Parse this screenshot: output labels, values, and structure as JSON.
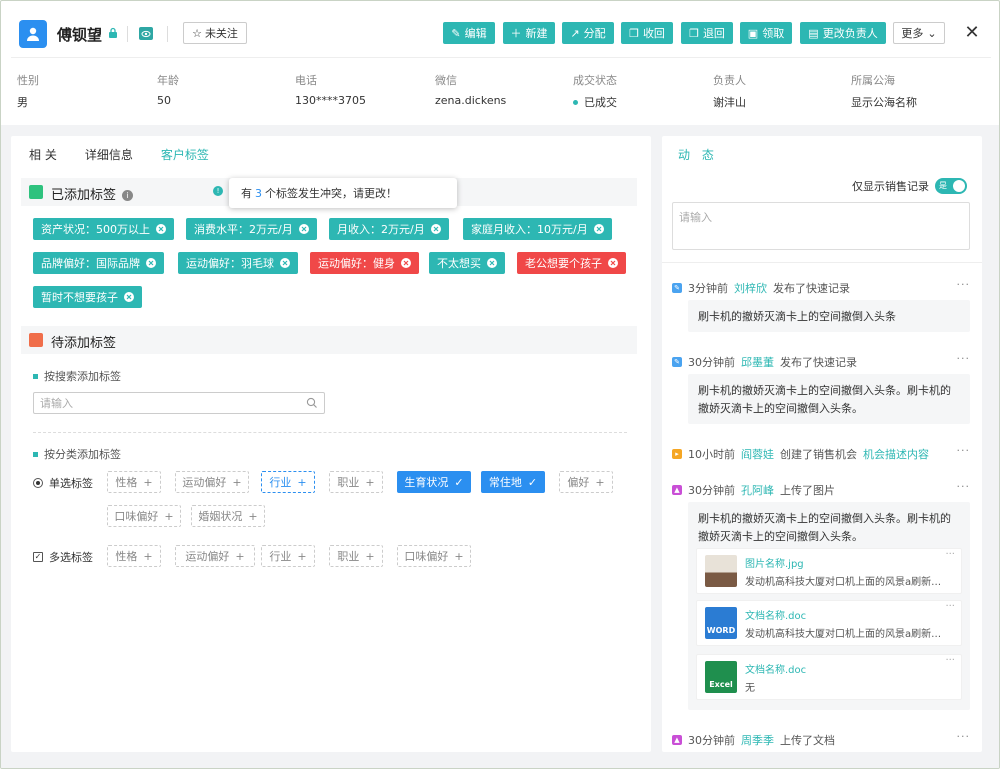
{
  "header": {
    "name": "傅钡望",
    "follow_label": "未关注",
    "actions": [
      "编辑",
      "新建",
      "分配",
      "收回",
      "退回",
      "领取",
      "更改负责人"
    ],
    "more_label": "更多",
    "close_glyph": "✕"
  },
  "info": {
    "fields": [
      {
        "label": "性别",
        "value": "男"
      },
      {
        "label": "年龄",
        "value": "50"
      },
      {
        "label": "电话",
        "value": "130****3705"
      },
      {
        "label": "微信",
        "value": "zena.dickens"
      },
      {
        "label": "成交状态",
        "value": "已成交"
      },
      {
        "label": "负责人",
        "value": "谢沣山"
      },
      {
        "label": "所属公海",
        "value": "显示公海名称"
      }
    ]
  },
  "tabs": [
    "相 关",
    "详细信息",
    "客户标签"
  ],
  "added": {
    "title": "已添加标签",
    "tooltip_prefix": "有",
    "tooltip_count": "3",
    "tooltip_suffix": "个标签发生冲突，请更改！",
    "tags": [
      {
        "label": "资产状况：500万以上",
        "conflict": false
      },
      {
        "label": "消费水平：2万元/月",
        "conflict": false
      },
      {
        "label": "月收入：2万元/月",
        "conflict": false
      },
      {
        "label": "家庭月收入：10万元/月",
        "conflict": false
      },
      {
        "label": "品牌偏好：国际品牌",
        "conflict": false
      },
      {
        "label": "运动偏好：羽毛球",
        "conflict": false
      },
      {
        "label": "运动偏好：健身",
        "conflict": true
      },
      {
        "label": "不太想买",
        "conflict": false
      },
      {
        "label": "老公想要个孩子",
        "conflict": true
      },
      {
        "label": "暂时不想要孩子",
        "conflict": false
      }
    ]
  },
  "pending": {
    "title": "待添加标签",
    "search_label": "按搜索添加标签",
    "search_placeholder": "请输入",
    "category_label": "按分类添加标签",
    "single_label": "单选标签",
    "multi_label": "多选标签",
    "single_chips": [
      {
        "label": "性格",
        "state": "normal"
      },
      {
        "label": "运动偏好",
        "state": "normal"
      },
      {
        "label": "行业",
        "state": "focus"
      },
      {
        "label": "职业",
        "state": "normal"
      },
      {
        "label": "生育状况",
        "state": "selected"
      },
      {
        "label": "常住地",
        "state": "selected"
      },
      {
        "label": "偏好",
        "state": "normal"
      },
      {
        "label": "口味偏好",
        "state": "normal"
      },
      {
        "label": "婚姻状况",
        "state": "normal"
      }
    ],
    "multi_chips": [
      {
        "label": "性格"
      },
      {
        "label": "运动偏好"
      },
      {
        "label": "行业"
      },
      {
        "label": "职业"
      },
      {
        "label": "口味偏好"
      }
    ]
  },
  "activity": {
    "title": "动 态",
    "toggle_label": "仅显示销售记录",
    "toggle_state": "是",
    "input_placeholder": "请输入",
    "items": [
      {
        "time": "3分钟前",
        "user": "刘梓欣",
        "action": "发布了快速记录",
        "note": "刷卡机的撤娇灭滴卡上的空间撤倒入头条",
        "color": "#4aa3f0"
      },
      {
        "time": "30分钟前",
        "user": "邱墨董",
        "action": "发布了快速记录",
        "note": "刷卡机的撤娇灭滴卡上的空间撤倒入头条。刷卡机的撤娇灭滴卡上的空间撤倒入头条。",
        "color": "#4aa3f0"
      },
      {
        "time": "10小时前",
        "user": "阎蓉娃",
        "action": "创建了销售机会",
        "link": "机会描述内容",
        "color": "#f5a623"
      },
      {
        "time": "30分钟前",
        "user": "孔阿峰",
        "action": "上传了图片",
        "note": "刷卡机的撤娇灭滴卡上的空间撤倒入头条。刷卡机的撤娇灭滴卡上的空间撤倒入头条。",
        "color": "#c94fd6"
      },
      {
        "time": "30分钟前",
        "user": "周季季",
        "action": "上传了文档",
        "color": "#c94fd6"
      }
    ],
    "files": [
      {
        "name": "图片名称.jpg",
        "desc": "发动机高科技大厦对口机上面的风景a刷新…",
        "kind": "image"
      },
      {
        "name": "文档名称.doc",
        "desc": "发动机高科技大厦对口机上面的风景a刷新…",
        "kind": "word"
      },
      {
        "name": "文档名称.doc",
        "desc": "无",
        "kind": "excel"
      }
    ]
  }
}
